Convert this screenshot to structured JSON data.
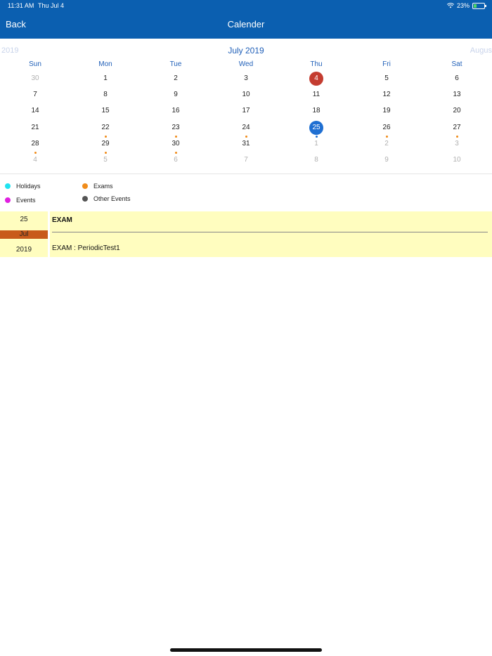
{
  "status_bar": {
    "time": "11:31 AM",
    "date": "Thu Jul 4",
    "battery": "23%"
  },
  "nav": {
    "back_label": "Back",
    "title": "Calender"
  },
  "calendar": {
    "prev_label": "2019",
    "month_label": "July 2019",
    "next_label": "Augus",
    "weekdays": [
      "Sun",
      "Mon",
      "Tue",
      "Wed",
      "Thu",
      "Fri",
      "Sat"
    ],
    "weeks": [
      [
        {
          "d": "30",
          "dim": true
        },
        {
          "d": "1"
        },
        {
          "d": "2"
        },
        {
          "d": "3"
        },
        {
          "d": "4",
          "today": true
        },
        {
          "d": "5"
        },
        {
          "d": "6"
        }
      ],
      [
        {
          "d": "7"
        },
        {
          "d": "8"
        },
        {
          "d": "9"
        },
        {
          "d": "10"
        },
        {
          "d": "11"
        },
        {
          "d": "12"
        },
        {
          "d": "13"
        }
      ],
      [
        {
          "d": "14"
        },
        {
          "d": "15"
        },
        {
          "d": "16"
        },
        {
          "d": "17"
        },
        {
          "d": "18"
        },
        {
          "d": "19"
        },
        {
          "d": "20"
        }
      ],
      [
        {
          "d": "21"
        },
        {
          "d": "22",
          "dot": "exam"
        },
        {
          "d": "23",
          "dot": "exam"
        },
        {
          "d": "24",
          "dot": "exam"
        },
        {
          "d": "25",
          "selected": true,
          "dot": "selected"
        },
        {
          "d": "26",
          "dot": "exam"
        },
        {
          "d": "27",
          "dot": "exam"
        }
      ],
      [
        {
          "d": "28",
          "dot": "exam"
        },
        {
          "d": "29",
          "dot": "exam"
        },
        {
          "d": "30",
          "dot": "exam"
        },
        {
          "d": "31"
        },
        {
          "d": "1",
          "dim": true
        },
        {
          "d": "2",
          "dim": true
        },
        {
          "d": "3",
          "dim": true
        }
      ],
      [
        {
          "d": "4",
          "dim": true
        },
        {
          "d": "5",
          "dim": true
        },
        {
          "d": "6",
          "dim": true
        },
        {
          "d": "7",
          "dim": true
        },
        {
          "d": "8",
          "dim": true
        },
        {
          "d": "9",
          "dim": true
        },
        {
          "d": "10",
          "dim": true
        }
      ]
    ]
  },
  "legend": {
    "holidays": "Holidays",
    "exams": "Exams",
    "events": "Events",
    "other_events": "Other Events",
    "colors": {
      "holidays": "#1fe3f0",
      "exams": "#f08c1a",
      "events": "#e01fe0",
      "other_events": "#555555"
    }
  },
  "event": {
    "day": "25",
    "month": "Jul",
    "year": "2019",
    "title": "EXAM",
    "description": "EXAM : PeriodicTest1"
  }
}
